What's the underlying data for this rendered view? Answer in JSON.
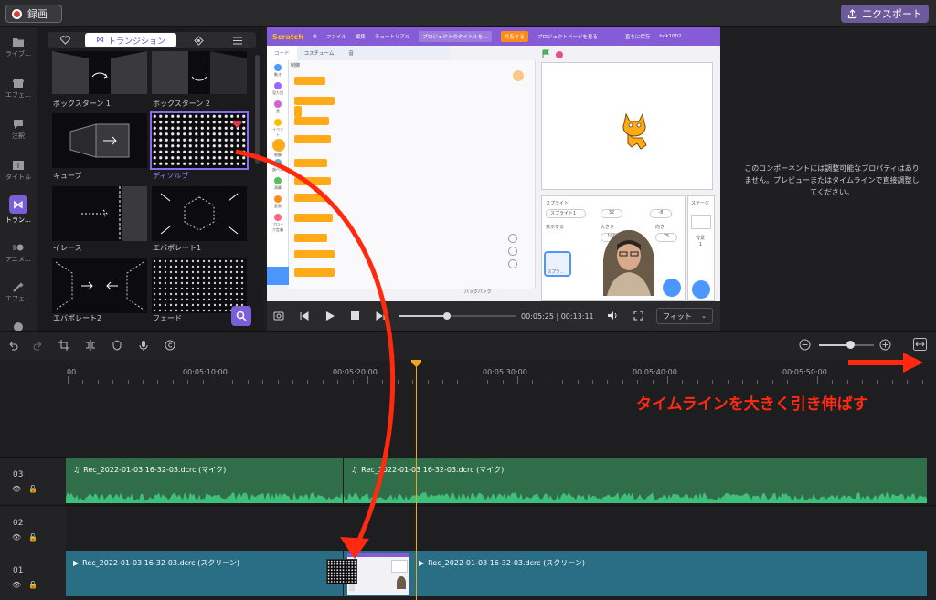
{
  "topbar": {
    "record_label": "録画",
    "export_label": "エクスポート"
  },
  "sidebar": {
    "items": [
      {
        "label": "ライブ…",
        "icon": "folder-icon"
      },
      {
        "label": "エフェ…",
        "icon": "store-icon"
      },
      {
        "label": "注釈",
        "icon": "comment-icon"
      },
      {
        "label": "タイトル",
        "icon": "title-icon"
      },
      {
        "label": "トラン…",
        "icon": "transition-icon"
      },
      {
        "label": "アニメ…",
        "icon": "animation-icon"
      },
      {
        "label": "エフェ…",
        "icon": "wand-icon"
      }
    ]
  },
  "panel": {
    "tab_label": "トランジション",
    "transitions": [
      {
        "label": "ボックスターン 1"
      },
      {
        "label": "ボックスターン 2"
      },
      {
        "label": "キューブ"
      },
      {
        "label": "ディソルブ"
      },
      {
        "label": "イレース"
      },
      {
        "label": "エバポレート1"
      },
      {
        "label": "エバポレート2"
      },
      {
        "label": "フェード"
      }
    ]
  },
  "preview": {
    "scratch": {
      "logo": "Scratch",
      "menu": [
        "ファイル",
        "編集",
        "チュートリアル"
      ],
      "title_field": "プロジェクトのタイトルを…",
      "share": "共有する",
      "project_page": "プロジェクトページを見る",
      "save": "直ちに保存",
      "user": "hdk1002",
      "tabs": [
        "コード",
        "コスチューム",
        "音"
      ],
      "categories": [
        "動き",
        "見た目",
        "音",
        "イベント",
        "制御",
        "調べる",
        "演算",
        "変数",
        "ブロック定義"
      ],
      "sprite_label": "スプライト",
      "sprite_name": "スプライト1",
      "x": "32",
      "y": "-8",
      "show_label": "表示する",
      "size_label": "大きさ",
      "size": "100",
      "direction_label": "向き",
      "direction": "75",
      "stage_label": "ステージ",
      "backdrop_label": "背景",
      "backdrop_count": "1",
      "sprite_thumb": "スプラ…",
      "backpack": "バックパック",
      "block_heading": "制御"
    },
    "time_current": "00:05:25",
    "time_total": "00:13:11",
    "fit_label": "フィット"
  },
  "props": {
    "message": "このコンポーネントには調整可能なプロパティはありません。プレビューまたはタイムラインで直接調整してください。"
  },
  "timeline": {
    "ruler": [
      "00",
      "00:05:10:00",
      "00:05:20:00",
      "00:05:30:00",
      "00:05:40:00",
      "00:05:50:00"
    ],
    "tracks": [
      {
        "num": "03",
        "clips": [
          "Rec_2022-01-03 16-32-03.dcrc (マイク)",
          "Rec_2022-01-03 16-32-03.dcrc (マイク)"
        ]
      },
      {
        "num": "02",
        "clips": []
      },
      {
        "num": "01",
        "clips": [
          "Rec_2022-01-03 16-32-03.dcrc (スクリーン)",
          "Rec_2022-01-03 16-32-03.dcrc (スクリーン)"
        ]
      }
    ],
    "zoom_level": 0.58
  },
  "annotation": {
    "text": "タイムラインを大きく引き伸ばす"
  },
  "colors": {
    "accent": "#7a5fd6",
    "audio_clip": "#2f6e49",
    "video_clip": "#2a6e86",
    "playhead": "#f0a81a",
    "annotation": "#ff2a10"
  }
}
